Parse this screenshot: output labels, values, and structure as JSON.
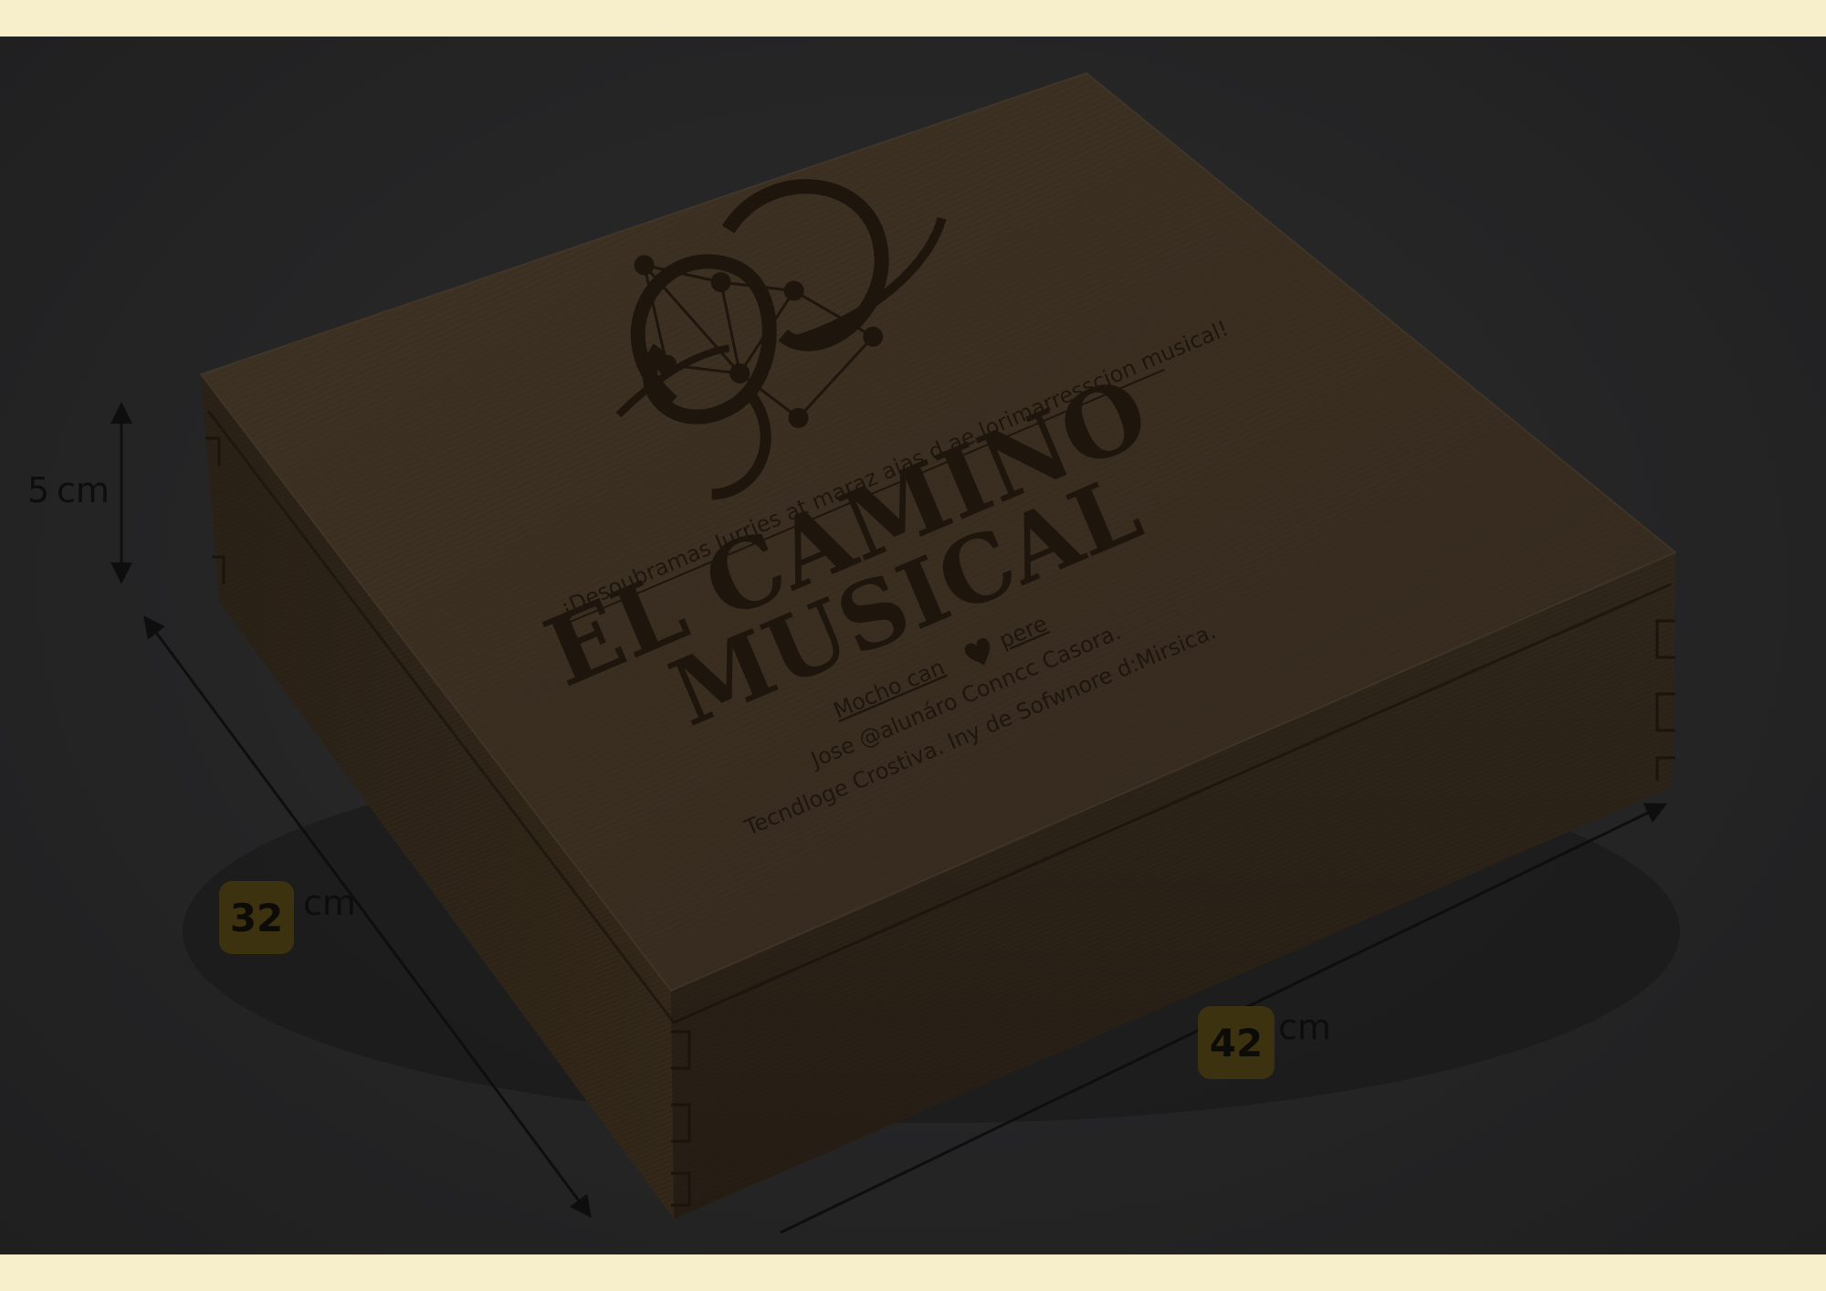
{
  "box": {
    "title_line1": "EL CAMINO",
    "title_line2": "MUSICAL",
    "tagline": "¡Desoubramas Jurries at maraz aias d ae lorimarresscion musical!",
    "line_made_with": "Mocho can",
    "line_made_with_end": "pere",
    "heart_icon": "heart-icon",
    "line_author": "Jose @alunáro Conncc Casora.",
    "line_profession": "Tecndloge Crostiva. Iny de Sofwnore d:Mirsica.",
    "monogram_icon": "monogram-constellation-icon"
  },
  "dimensions": {
    "height_value": "5",
    "height_unit": "cm",
    "depth_value": "32",
    "depth_unit": "cm",
    "width_value": "42",
    "width_unit": "cm"
  },
  "colors": {
    "background_band": "#f7eecb",
    "stage": "#262627",
    "wood_top": "#3b2f22",
    "wood_side": "#2c2319",
    "badge": "#3d3210",
    "engraving": "#1e160d"
  }
}
